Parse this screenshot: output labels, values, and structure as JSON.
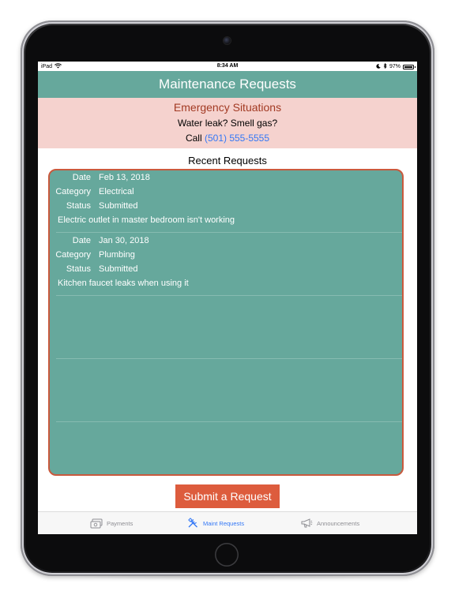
{
  "status_bar": {
    "device": "iPad",
    "time": "8:34 AM",
    "battery": "97%",
    "battery_level": 0.97
  },
  "nav": {
    "title": "Maintenance Requests"
  },
  "emergency": {
    "title": "Emergency Situations",
    "line": "Water leak?  Smell gas?",
    "call_prefix": "Call",
    "phone": "(501) 555-5555"
  },
  "recent": {
    "title": "Recent Requests",
    "labels": {
      "date": "Date",
      "category": "Category",
      "status": "Status"
    },
    "items": [
      {
        "date": "Feb 13, 2018",
        "category": "Electrical",
        "status": "Submitted",
        "description": "Electric outlet in master bedroom isn't working"
      },
      {
        "date": "Jan 30, 2018",
        "category": "Plumbing",
        "status": "Submitted",
        "description": "Kitchen faucet leaks when using it"
      }
    ]
  },
  "submit": {
    "label": "Submit a Request"
  },
  "tabs": [
    {
      "label": "Payments",
      "icon": "payments-icon",
      "active": false
    },
    {
      "label": "Maint Requests",
      "icon": "tools-icon",
      "active": true
    },
    {
      "label": "Announcements",
      "icon": "megaphone-icon",
      "active": false
    }
  ],
  "colors": {
    "teal": "#66a89c",
    "emergency_bg": "#f5d2ce",
    "emergency_title": "#a23a23",
    "accent_orange": "#dd5c3d",
    "link_blue": "#3478f6"
  }
}
